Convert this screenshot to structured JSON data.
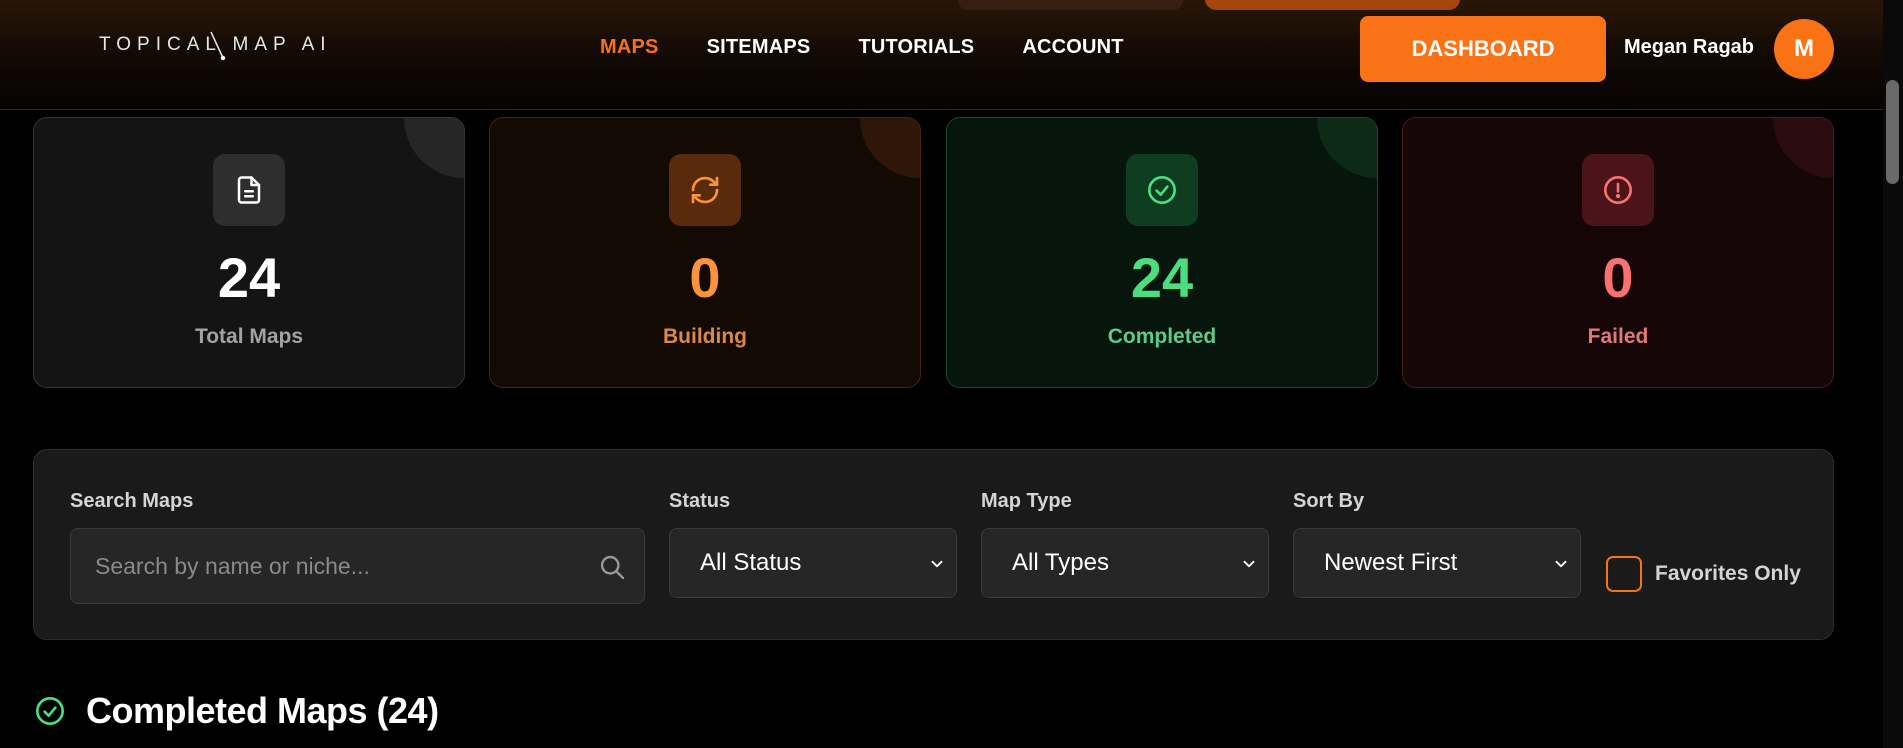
{
  "brand": {
    "logo_text": "TOPICAL MAP AI"
  },
  "nav": {
    "items": [
      {
        "label": "MAPS",
        "active": true
      },
      {
        "label": "SITEMAPS",
        "active": false
      },
      {
        "label": "TUTORIALS",
        "active": false
      },
      {
        "label": "ACCOUNT",
        "active": false
      }
    ],
    "dashboard_label": "DASHBOARD",
    "user_name": "Megan Ragab",
    "avatar_initial": "M"
  },
  "stats": {
    "total": {
      "value": "24",
      "label": "Total Maps",
      "icon": "document-icon"
    },
    "building": {
      "value": "0",
      "label": "Building",
      "icon": "refresh-icon"
    },
    "completed": {
      "value": "24",
      "label": "Completed",
      "icon": "check-circle-icon"
    },
    "failed": {
      "value": "0",
      "label": "Failed",
      "icon": "alert-circle-icon"
    }
  },
  "filters": {
    "search_label": "Search Maps",
    "search_placeholder": "Search by name or niche...",
    "search_value": "",
    "status_label": "Status",
    "status_value": "All Status",
    "type_label": "Map Type",
    "type_value": "All Types",
    "sort_label": "Sort By",
    "sort_value": "Newest First",
    "favorites_label": "Favorites Only",
    "favorites_checked": false
  },
  "section": {
    "title": "Completed Maps (24)",
    "icon": "check-circle-icon"
  },
  "colors": {
    "accent": "#f97316",
    "success": "#4ade80",
    "danger": "#f87171",
    "warning": "#fb923c"
  }
}
